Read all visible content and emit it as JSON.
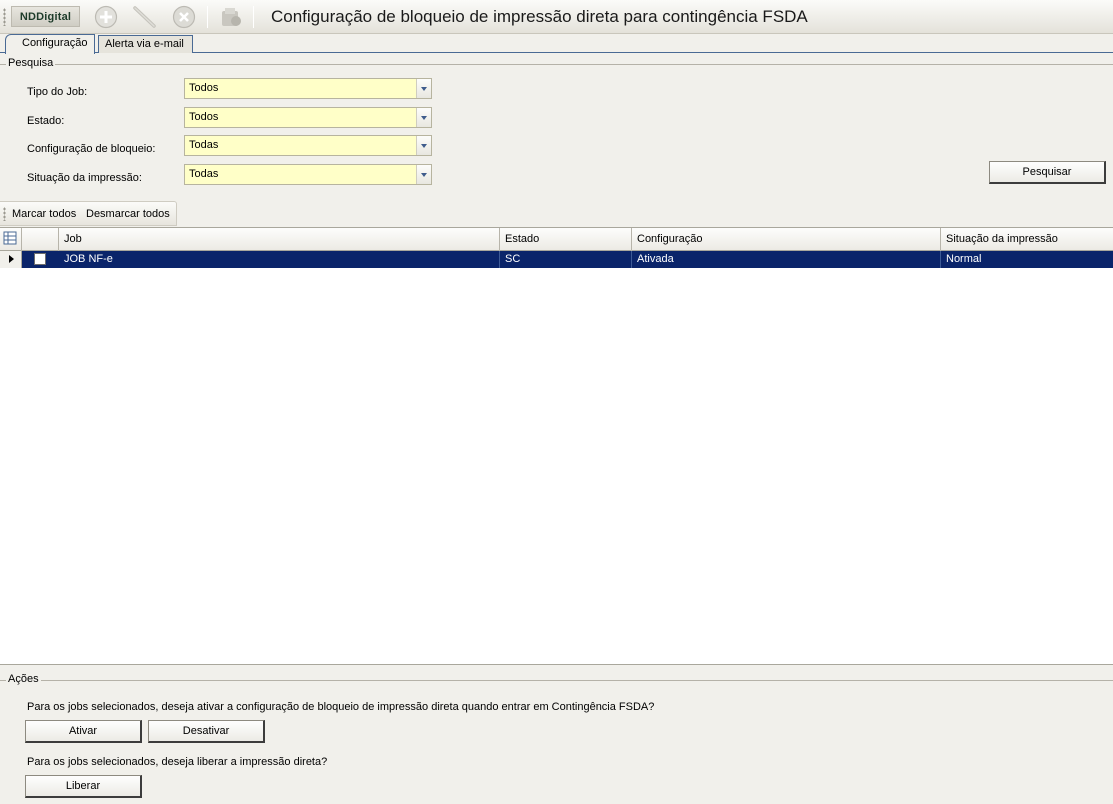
{
  "app": {
    "logo": "NDDigital",
    "title": "Configuração de bloqueio de impressão direta para contingência FSDA"
  },
  "toolbar": {
    "icons": [
      "add-icon",
      "edit-icon",
      "delete-icon",
      "report-icon"
    ]
  },
  "tabs": [
    {
      "label": "Configuração",
      "active": true
    },
    {
      "label": "Alerta via e-mail",
      "active": false
    }
  ],
  "search": {
    "group_label": "Pesquisa",
    "fields": [
      {
        "label": "Tipo do Job:",
        "value": "Todos"
      },
      {
        "label": "Estado:",
        "value": "Todos"
      },
      {
        "label": "Configuração de bloqueio:",
        "value": "Todas"
      },
      {
        "label": "Situação da impressão:",
        "value": "Todas"
      }
    ],
    "button_label": "Pesquisar"
  },
  "marks": {
    "select_all": "Marcar todos",
    "deselect_all": "Desmarcar todos"
  },
  "grid": {
    "columns": [
      "Job",
      "Estado",
      "Configuração",
      "Situação da impressão"
    ],
    "rows": [
      {
        "job": "JOB NF-e",
        "estado": "SC",
        "configuracao": "Ativada",
        "situacao": "Normal",
        "checked": false,
        "selected": true
      }
    ]
  },
  "actions": {
    "group_label": "Ações",
    "question_1": "Para os jobs selecionados, deseja ativar a configuração de bloqueio de impressão direta quando entrar em Contingência FSDA?",
    "activate_label": "Ativar",
    "deactivate_label": "Desativar",
    "question_2": "Para os jobs selecionados, deseja liberar a impressão direta?",
    "release_label": "Liberar"
  },
  "colors": {
    "combo_background": "#ffffc8",
    "selected_row": "#0a246a",
    "window_background": "#f1f0eb"
  }
}
